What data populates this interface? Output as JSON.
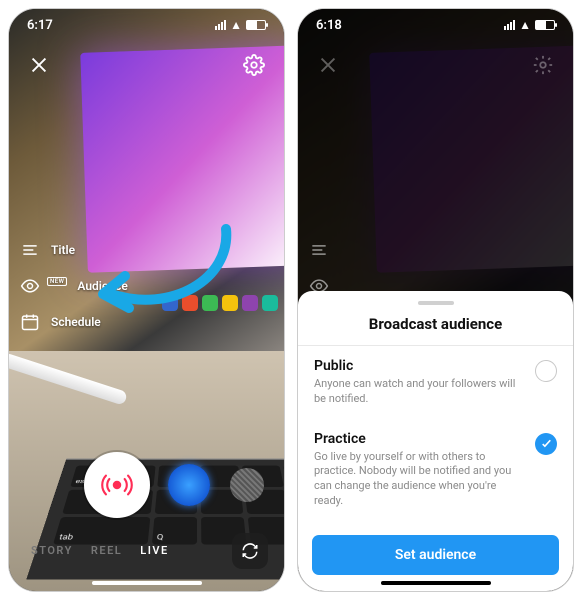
{
  "left": {
    "time": "6:17",
    "settings": {
      "title_label": "Title",
      "audience_label": "Audience",
      "audience_badge": "NEW",
      "schedule_label": "Schedule"
    },
    "keys": {
      "esc": "esc",
      "tab": "tab",
      "q": "Q"
    },
    "modes": {
      "story": "STORY",
      "reel": "REEL",
      "live": "LIVE"
    }
  },
  "right": {
    "time": "6:18",
    "sheet": {
      "heading": "Broadcast audience",
      "public_title": "Public",
      "public_desc": "Anyone can watch and your followers will be notified.",
      "practice_title": "Practice",
      "practice_desc": "Go live by yourself or with others to practice. Nobody will be notified and you can change the audience when you're ready.",
      "cta": "Set audience"
    }
  }
}
